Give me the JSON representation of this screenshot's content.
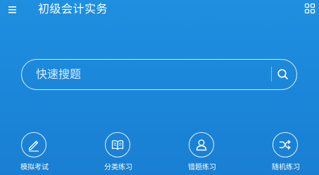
{
  "header": {
    "title": "初级会计实务",
    "menu_icon": "hamburger-menu-icon",
    "grid_icon": "grid-apps-icon"
  },
  "search": {
    "placeholder": "快速搜题",
    "icon": "search-icon"
  },
  "quick_actions": [
    {
      "label": "模拟考试",
      "icon": "pencil-icon"
    },
    {
      "label": "分类练习",
      "icon": "book-icon"
    },
    {
      "label": "错题练习",
      "icon": "user-icon"
    },
    {
      "label": "随机练习",
      "icon": "shuffle-icon"
    }
  ],
  "colors": {
    "background": "#1b86d9",
    "foreground": "#ffffff"
  }
}
